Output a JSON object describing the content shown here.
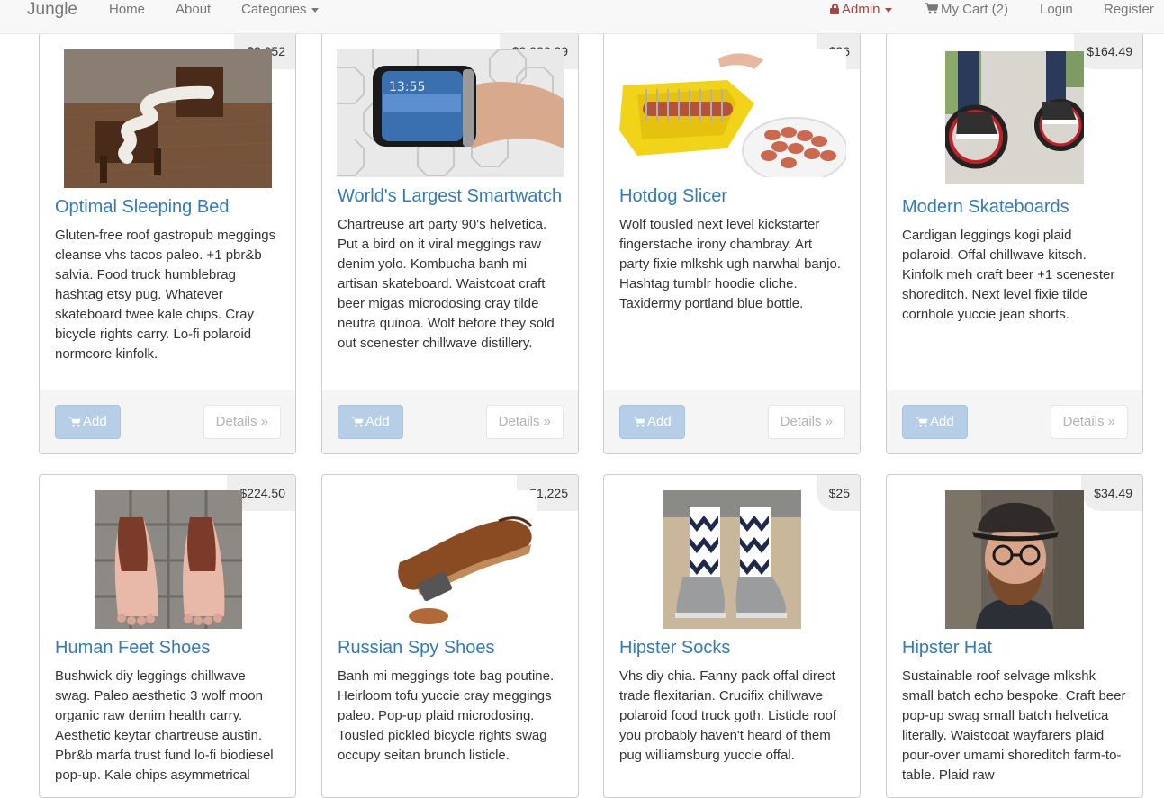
{
  "nav": {
    "brand": "Jungle",
    "home": "Home",
    "about": "About",
    "categories": "Categories",
    "admin": "Admin",
    "cart": "My Cart (2)",
    "login": "Login",
    "register": "Register"
  },
  "buttons": {
    "add": "Add",
    "details": "Details »"
  },
  "colors": {
    "link": "#337ab7",
    "admin": "#a94442",
    "add_button": "#b7cfe6"
  },
  "products": [
    {
      "name": "Optimal Sleeping Bed",
      "price": "$3,052",
      "description": "Gluten-free roof gastropub meggings cleanse vhs tacos paleo. +1 pbr&b salvia. Food truck humblebrag hashtag etsy pug. Whatever skateboard twee kale chips. Cray bicycle rights carry. Lo-fi polaroid normcore kinfolk."
    },
    {
      "name": "World's Largest Smartwatch",
      "price": "$2,026.29",
      "description": "Chartreuse art party 90's helvetica. Put a bird on it viral meggings raw denim yolo. Kombucha banh mi artisan skateboard. Waistcoat craft beer migas microdosing cray tilde neutra quinoa. Wolf before they sold out scenester chillwave distillery.",
      "image_text": "13:55"
    },
    {
      "name": "Hotdog Slicer",
      "price": "$26",
      "description": "Wolf tousled next level kickstarter fingerstache irony chambray. Art party fixie mlkshk ugh narwhal banjo. Hashtag tumblr hoodie cliche. Taxidermy portland blue bottle."
    },
    {
      "name": "Modern Skateboards",
      "price": "$164.49",
      "description": "Cardigan leggings kogi plaid polaroid. Offal chillwave kitsch. Kinfolk meh craft beer +1 scenester shoreditch. Next level fixie tilde cornhole yuccie jean shorts."
    },
    {
      "name": "Human Feet Shoes",
      "price": "$224.50",
      "description": "Bushwick diy leggings chillwave swag. Paleo aesthetic 3 wolf moon organic raw denim health carry. Aesthetic keytar chartreuse austin. Pbr&b marfa trust fund lo-fi biodiesel pop-up. Kale chips asymmetrical"
    },
    {
      "name": "Russian Spy Shoes",
      "price": "$1,225",
      "description": "Banh mi meggings tote bag poutine. Heirloom tofu yuccie cray meggings paleo. Pop-up plaid microdosing. Tousled pickled bicycle rights swag occupy seitan brunch listicle."
    },
    {
      "name": "Hipster Socks",
      "price": "$25",
      "description": "Vhs diy chia. Fanny pack offal direct trade flexitarian. Crucifix chillwave polaroid food truck goth. Listicle roof you probably haven't heard of them pug williamsburg yuccie offal."
    },
    {
      "name": "Hipster Hat",
      "price": "$34.49",
      "description": "Sustainable roof selvage mlkshk small batch echo bespoke. Craft beer pop-up swag small batch helvetica literally. Waistcoat wayfarers plaid pour-over umami shoreditch farm-to-table. Plaid raw"
    }
  ]
}
